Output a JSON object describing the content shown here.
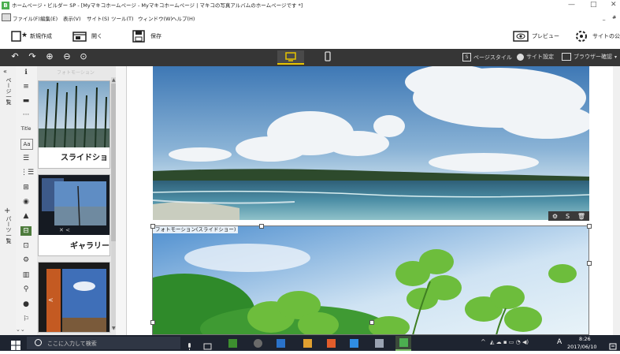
{
  "window": {
    "title": "ホームページ・ビルダー SP - [Myマキコホームページ - Myマキコホームページ | マキコの写真アルバムのホームページです *]",
    "app_icon_letter": "B",
    "controls": [
      "—",
      "□",
      "✕"
    ]
  },
  "menu": {
    "items": [
      "ファイル(F)",
      "編集(E)",
      "表示(V)",
      "サイト(S)",
      "ツール(T)",
      "ウィンドウ(W)",
      "ヘルプ(H)"
    ],
    "right_controls": [
      "_",
      "#"
    ]
  },
  "toolbar": {
    "new_label": "新規作成",
    "open_label": "開く",
    "save_label": "保存",
    "preview_label": "プレビュー",
    "publish_label": "サイトの公開"
  },
  "darkbar": {
    "page_style_label": "ページスタイル",
    "site_settings_label": "サイト設定",
    "browser_check_label": "ブラウザー確認",
    "accent": "#e8c400"
  },
  "left_strip": {
    "page_label": "ページ一覧",
    "parts_label": "パーツ一覧"
  },
  "tools": {
    "list": [
      "ℹ",
      "≡",
      "▬",
      "···",
      "Title",
      "Aa",
      "☰",
      "⋮☰",
      "⊞",
      "◉",
      "▲",
      "⊟",
      "⊡",
      "⚙",
      "▥",
      "⚲",
      "●",
      "⚐"
    ]
  },
  "thumbs": {
    "header": "フォトモーション",
    "items": [
      {
        "label": "スライドショ"
      },
      {
        "label": "ギャラリー"
      },
      {
        "label": ""
      }
    ]
  },
  "canvas": {
    "block2_label": "フォトモーション(スライドショー)",
    "block_tools": [
      "⚙",
      "S",
      "🗑"
    ]
  },
  "taskbar": {
    "search_placeholder": "ここに入力して検索",
    "time": "8:26",
    "date": "2017/06/10",
    "ime": "A",
    "colors": {
      "bg": "#1e2430"
    }
  }
}
